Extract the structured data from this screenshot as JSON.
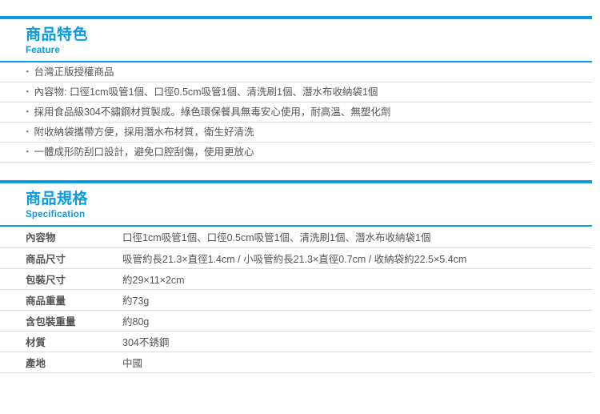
{
  "theme": {
    "accent": "#0c9ae0",
    "text": "#555555",
    "rule": "#dcdcdc",
    "background": "#ffffff"
  },
  "feature_section": {
    "title_cn": "商品特色",
    "title_en": "Feature",
    "bullet_char": "・",
    "items": [
      "台灣正版授權商品",
      "內容物: 口徑1cm吸管1個、口徑0.5cm吸管1個、清洗刷1個、潛水布收納袋1個",
      "採用食品級304不鏽鋼材質製成。綠色環保餐具無毒安心使用，耐高溫、無塑化劑",
      "附收納袋攜帶方便，採用潛水布材質，衛生好清洗",
      "一體成形防刮口設計，避免口腔刮傷，使用更放心"
    ]
  },
  "spec_section": {
    "title_cn": "商品規格",
    "title_en": "Specification",
    "rows": [
      {
        "label": "內容物",
        "value": "口徑1cm吸管1個、口徑0.5cm吸管1個、清洗刷1個、潛水布收納袋1個"
      },
      {
        "label": "商品尺寸",
        "value": "吸管約長21.3×直徑1.4cm / 小吸管約長21.3×直徑0.7cm / 收納袋約22.5×5.4cm"
      },
      {
        "label": "包裝尺寸",
        "value": "約29×11×2cm"
      },
      {
        "label": "商品重量",
        "value": "約73g"
      },
      {
        "label": "含包裝重量",
        "value": "約80g"
      },
      {
        "label": "材質",
        "value": "304不銹鋼"
      },
      {
        "label": "產地",
        "value": "中國"
      }
    ]
  }
}
